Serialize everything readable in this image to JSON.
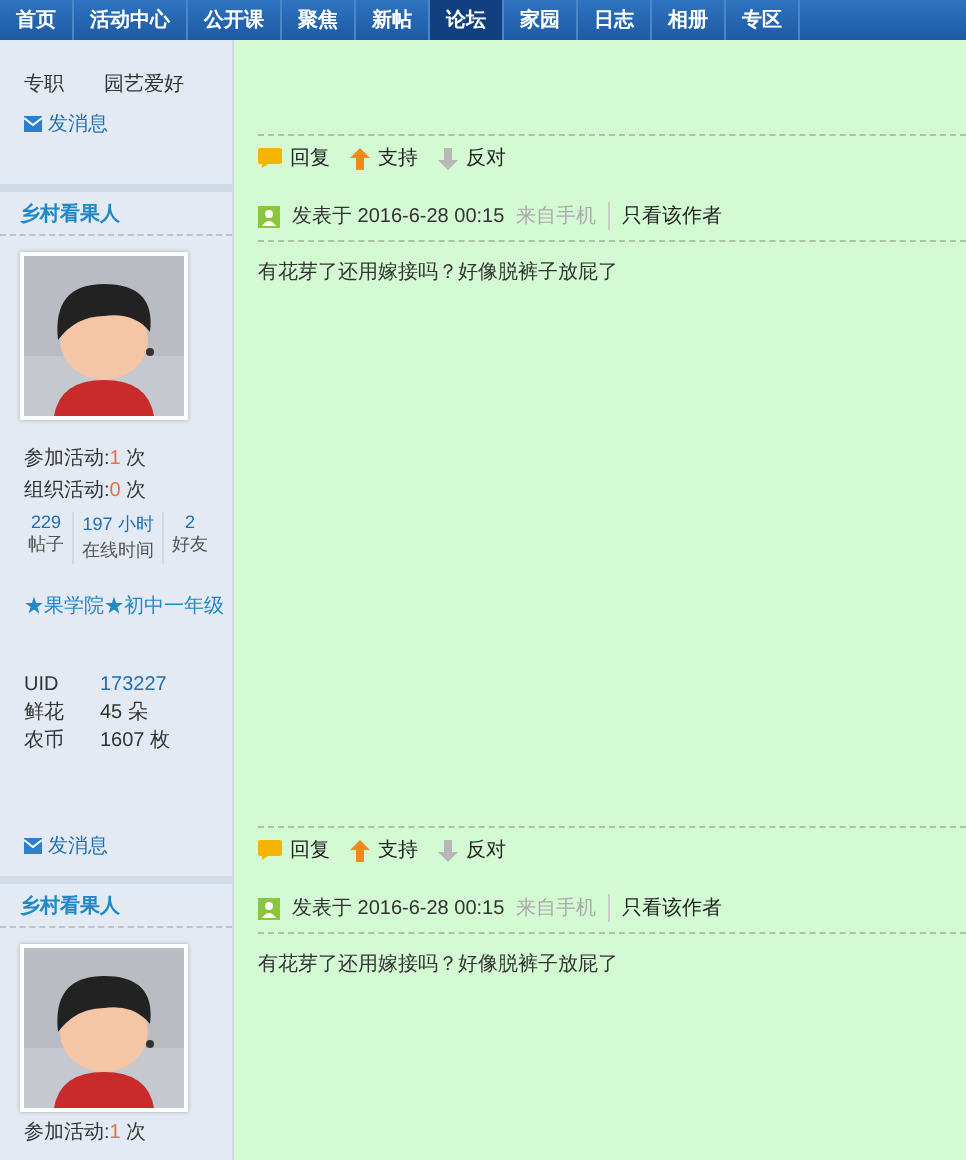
{
  "nav": [
    {
      "label": "首页",
      "selected": false
    },
    {
      "label": "活动中心",
      "selected": false
    },
    {
      "label": "公开课",
      "selected": false
    },
    {
      "label": "聚焦",
      "selected": false
    },
    {
      "label": "新帖",
      "selected": false
    },
    {
      "label": "论坛",
      "selected": true
    },
    {
      "label": "家园",
      "selected": false
    },
    {
      "label": "日志",
      "selected": false
    },
    {
      "label": "相册",
      "selected": false
    },
    {
      "label": "专区",
      "selected": false
    }
  ],
  "posts": [
    {
      "profile_fields": [
        "专职",
        "园艺爱好"
      ],
      "message_link": "发消息",
      "actions": [
        "回复",
        "支持",
        "反对"
      ]
    },
    {
      "author": "乡村看果人",
      "avatar": {
        "kind": "picture"
      },
      "activity": [
        {
          "label": "参加活动:",
          "value": "1",
          "unit": " 次"
        },
        {
          "label": "组织活动:",
          "value": "0",
          "unit": " 次"
        }
      ],
      "stats": [
        {
          "value": "229",
          "label": "帖子"
        },
        {
          "value": "197 小时",
          "label": "在线时间"
        },
        {
          "value": "2",
          "label": "好友"
        }
      ],
      "rank": "★果学院★初中一年级",
      "details": [
        {
          "label": "UID",
          "value": "173227",
          "link": true
        },
        {
          "label": "鲜花",
          "value": "45 朵",
          "link": false
        },
        {
          "label": "农币",
          "value": "1607 枚",
          "link": false
        }
      ],
      "message_link": "发消息",
      "meta": {
        "prefix": "发表于",
        "time": "2016-6-28 00:15",
        "source": "来自手机",
        "filter": "只看该作者"
      },
      "content": "有花芽了还用嫁接吗？好像脱裤子放屁了",
      "actions": [
        "回复",
        "支持",
        "反对"
      ]
    },
    {
      "author": "乡村看果人",
      "avatar": {
        "kind": "picture"
      },
      "activity": [
        {
          "label": "参加活动:",
          "value": "1",
          "unit": " 次"
        }
      ],
      "meta": {
        "prefix": "发表于",
        "time": "2016-6-28 00:15",
        "source": "来自手机",
        "filter": "只看该作者"
      },
      "content": "有花芽了还用嫁接吗？好像脱裤子放屁了"
    }
  ]
}
